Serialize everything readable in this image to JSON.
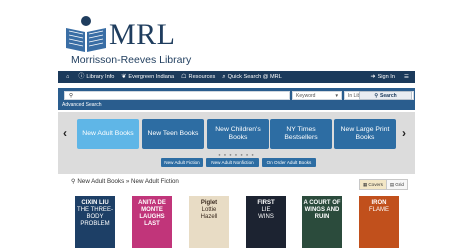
{
  "logo": {
    "abbr": "MRL",
    "name": "Morrisson-Reeves Library"
  },
  "nav": {
    "items": [
      {
        "icon": "info-icon",
        "glyph": "ⓘ",
        "label": "Library Info"
      },
      {
        "icon": "ribbon-icon",
        "glyph": "❦",
        "label": "Evergreen Indiana"
      },
      {
        "icon": "building-icon",
        "glyph": "☖",
        "label": "Resources"
      },
      {
        "icon": "search-icon",
        "glyph": "⌕",
        "label": "Quick Search @ MRL"
      }
    ],
    "signin": "Sign In"
  },
  "search": {
    "query": "",
    "field": "Keyword",
    "scope": "In Library Catalog",
    "button": "Search",
    "advanced": "Advanced Search"
  },
  "carousel": {
    "tiles": [
      "New Adult Books",
      "New Teen Books",
      "New Children's Books",
      "NY Times Bestsellers",
      "New Large Print Books"
    ],
    "dots": "● ● ● ● ● ● ●",
    "subbuttons": [
      "New Adult Fiction",
      "New Adult Nonfiction",
      "On Order Adult Books"
    ]
  },
  "results": {
    "breadcrumb": "New Adult Books » New Adult Fiction",
    "view_covers": "Covers",
    "view_grid": "Grid"
  },
  "books": [
    {
      "title": "CIXIN LIU\nTHE THREE-BODY PROBLEM",
      "color": "#1d3f66"
    },
    {
      "title": "ANITA DE MONTE LAUGHS LAST",
      "color": "#c1357a"
    },
    {
      "title": "Piglet\nLottie\nHazell",
      "color": "#e8dcc5"
    },
    {
      "title": "FIRST\nLIE\nWINS",
      "color": "#1c2331"
    },
    {
      "title": "A COURT OF WINGS AND RUIN",
      "color": "#2b4b3c"
    },
    {
      "title": "IRON\nFLAME",
      "color": "#c1501c"
    }
  ]
}
